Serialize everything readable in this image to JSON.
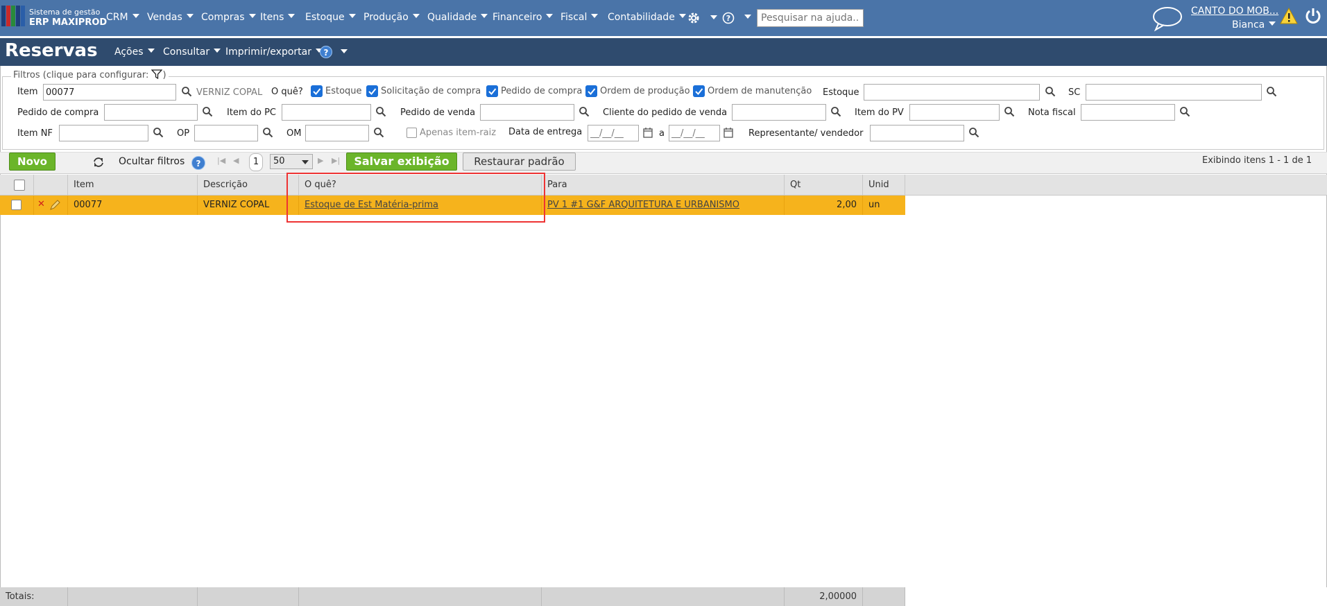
{
  "app": {
    "brand_line1": "Sistema de gestão",
    "brand_line2": "ERP MAXIPROD",
    "menu": [
      "CRM",
      "Vendas",
      "Compras",
      "Itens",
      "Estoque",
      "Produção",
      "Qualidade",
      "Financeiro",
      "Fiscal",
      "Contabilidade"
    ],
    "search_placeholder": "Pesquisar na ajuda...",
    "company": "CANTO DO MOB...",
    "user": "Bianca",
    "icons": [
      "settings-gear-icon",
      "help-icon",
      "chat-bubble-icon",
      "warning-icon",
      "power-icon"
    ]
  },
  "page": {
    "title": "Reservas",
    "menu": [
      "Ações",
      "Consultar",
      "Imprimir/exportar"
    ]
  },
  "filters": {
    "legend": "Filtros (clique para configurar:",
    "legend_end": ")",
    "item_label": "Item",
    "item_value": "00077",
    "item_desc": "VERNIZ COPAL",
    "oque_label": "O quê?",
    "checks": [
      {
        "label": "Estoque",
        "checked": true
      },
      {
        "label": "Solicitação de compra",
        "checked": true
      },
      {
        "label": "Pedido de compra",
        "checked": true
      },
      {
        "label": "Ordem de produção",
        "checked": true
      },
      {
        "label": "Ordem de manutenção",
        "checked": true
      }
    ],
    "estoque_label": "Estoque",
    "sc_label": "SC",
    "pedido_compra_label": "Pedido de compra",
    "item_pc_label": "Item do PC",
    "pedido_venda_label": "Pedido de venda",
    "cliente_pv_label": "Cliente do pedido de venda",
    "item_pv_label": "Item do PV",
    "nota_fiscal_label": "Nota fiscal",
    "item_nf_label": "Item NF",
    "op_label": "OP",
    "om_label": "OM",
    "apenas_raiz_label": "Apenas item-raiz",
    "data_entrega_label": "Data de entrega",
    "date_placeholder": "__/__/__",
    "date_sep": "a",
    "representante_label": "Representante/ vendedor"
  },
  "toolbar": {
    "novo": "Novo",
    "ocultar_filtros": "Ocultar filtros",
    "page": "1",
    "per_page": "50",
    "salvar": "Salvar exibição",
    "restaurar": "Restaurar padrão",
    "status": "Exibindo itens 1 - 1 de 1"
  },
  "grid": {
    "columns": [
      "Item",
      "Descrição",
      "O quê?",
      "Para",
      "Qt",
      "Unid"
    ],
    "rows": [
      {
        "item": "00077",
        "descricao": "VERNIZ COPAL",
        "oque": "Estoque de Est Matéria-prima",
        "para": "PV 1 #1 G&F ARQUITETURA E URBANISMO",
        "qt": "2,00",
        "unid": "un"
      }
    ],
    "totals_label": "Totais:",
    "totals_qt": "2,00000"
  },
  "colors": {
    "nav": "#4a74a8",
    "titlebar": "#2f4b6e",
    "row": "#f6b31c",
    "green": "#6bb52a"
  }
}
